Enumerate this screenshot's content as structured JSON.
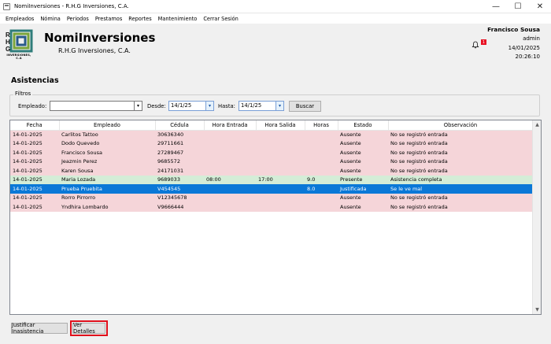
{
  "window": {
    "title": "NomiInversiones - R.H.G Inversiones, C.A.",
    "minimize": "—",
    "maximize": "☐",
    "close": "✕"
  },
  "menu": [
    "Empleados",
    "Nómina",
    "Periodos",
    "Prestamos",
    "Reportes",
    "Mantenimiento",
    "Cerrar Sesión"
  ],
  "header": {
    "logo_text": "INVERSIONES, C.A",
    "app_name": "NomiInversiones",
    "company": "R.H.G Inversiones, C.A.",
    "notification_count": "1",
    "user_name": "Francisco Sousa",
    "user_role": "admin",
    "date": "14/01/2025",
    "time": "20:26:10"
  },
  "page": {
    "title": "Asistencias",
    "filters_label": "Filtros",
    "employee_label": "Empleado:",
    "employee_value": "",
    "from_label": "Desde:",
    "from_value": "14/1/25",
    "to_label": "Hasta:",
    "to_value": "14/1/25",
    "search_button": "Buscar"
  },
  "table": {
    "columns": [
      "Fecha",
      "Empleado",
      "Cédula",
      "Hora Entrada",
      "Hora Salida",
      "Horas",
      "Estado",
      "Observación"
    ],
    "rows": [
      {
        "fecha": "14-01-2025",
        "empleado": "Carlitos Tattoo",
        "cedula": "30636340",
        "entrada": "",
        "salida": "",
        "horas": "",
        "estado": "Ausente",
        "obs": "No se registró entrada",
        "kind": "absent"
      },
      {
        "fecha": "14-01-2025",
        "empleado": "Dodo Quevedo",
        "cedula": "29711661",
        "entrada": "",
        "salida": "",
        "horas": "",
        "estado": "Ausente",
        "obs": "No se registró entrada",
        "kind": "absent"
      },
      {
        "fecha": "14-01-2025",
        "empleado": "Francisco Sousa",
        "cedula": "27289467",
        "entrada": "",
        "salida": "",
        "horas": "",
        "estado": "Ausente",
        "obs": "No se registró entrada",
        "kind": "absent"
      },
      {
        "fecha": "14-01-2025",
        "empleado": "Jeazmin Perez",
        "cedula": "9685572",
        "entrada": "",
        "salida": "",
        "horas": "",
        "estado": "Ausente",
        "obs": "No se registró entrada",
        "kind": "absent"
      },
      {
        "fecha": "14-01-2025",
        "empleado": "Karen Sousa",
        "cedula": "24171031",
        "entrada": "",
        "salida": "",
        "horas": "",
        "estado": "Ausente",
        "obs": "No se registró entrada",
        "kind": "absent"
      },
      {
        "fecha": "14-01-2025",
        "empleado": "Maria Lozada",
        "cedula": "9689033",
        "entrada": "08:00",
        "salida": "17:00",
        "horas": "9.0",
        "estado": "Presente",
        "obs": "Asistencia completa",
        "kind": "present"
      },
      {
        "fecha": "14-01-2025",
        "empleado": "Prueba Pruebita",
        "cedula": "V454545",
        "entrada": "",
        "salida": "",
        "horas": "8.0",
        "estado": "Justificada",
        "obs": "Se le ve mal",
        "kind": "justified"
      },
      {
        "fecha": "14-01-2025",
        "empleado": "Rorro Pirrorro",
        "cedula": "V12345678",
        "entrada": "",
        "salida": "",
        "horas": "",
        "estado": "Ausente",
        "obs": "No se registró entrada",
        "kind": "absent"
      },
      {
        "fecha": "14-01-2025",
        "empleado": "Yndhira Lombardo",
        "cedula": "V9666444",
        "entrada": "",
        "salida": "",
        "horas": "",
        "estado": "Ausente",
        "obs": "No se registró entrada",
        "kind": "absent"
      }
    ]
  },
  "footer": {
    "justify_button": "Justificar Inasistencia",
    "details_button": "Ver Detalles"
  },
  "colors": {
    "absent_row": "#f5d5d9",
    "present_row": "#d4edd7",
    "selected_row": "#0a78d7",
    "highlight": "#e0101c",
    "badge": "#e81123"
  },
  "icons": {
    "app": "window-app-icon",
    "bell": "bell-icon",
    "dropdown": "chevron-down-icon",
    "date": "calendar-dropdown-icon"
  }
}
